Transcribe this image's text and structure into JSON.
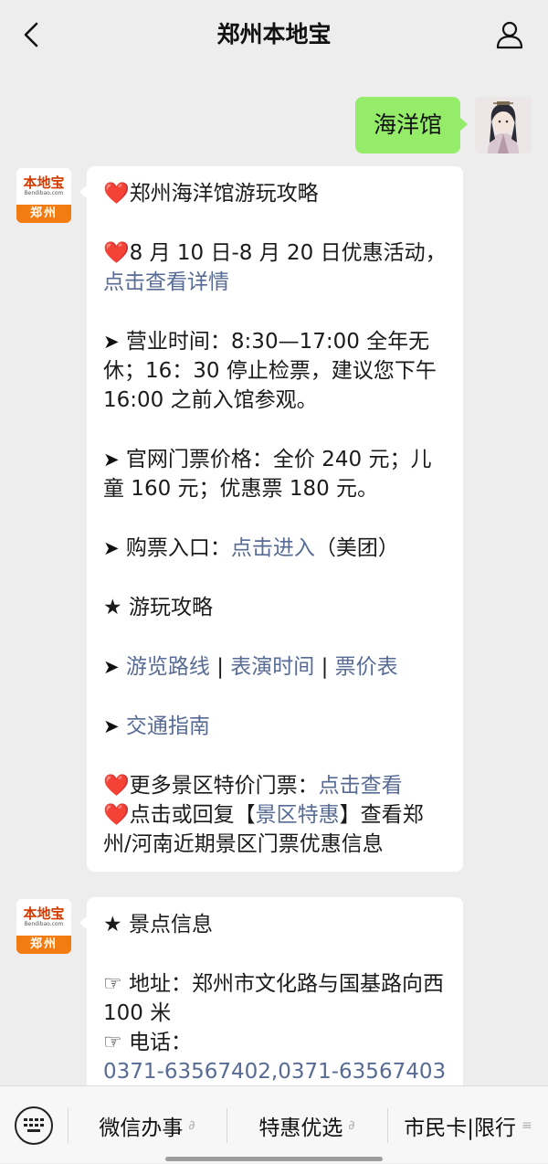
{
  "header": {
    "title": "郑州本地宝"
  },
  "outgoing": {
    "text": "海洋馆"
  },
  "bot": {
    "logo_main": "本地宝",
    "logo_sub": "Bendibao.com",
    "logo_city": "郑州"
  },
  "message1": {
    "title_heart": "❤️",
    "title": "郑州海洋馆游玩攻略",
    "promo_heart": "❤️",
    "promo_text": "8 月 10 日-8 月 20 日优惠活动，",
    "promo_link": "点击查看详情",
    "hours_arrow": "➤",
    "hours_text": "营业时间：8:30—17:00 全年无休；16：30 停止检票，建议您下午 16:00 之前入馆参观。",
    "price_arrow": "➤",
    "price_text": "官网门票价格：全价 240 元；儿童 160 元；优惠票 180 元。",
    "buy_arrow": "➤",
    "buy_label": "购票入口：",
    "buy_link": "点击进入",
    "buy_suffix": "（美团）",
    "guide_star": "★",
    "guide_title": "游玩攻略",
    "links_arrow": "➤",
    "link_route": "游览路线",
    "sep1": " | ",
    "link_show": "表演时间",
    "sep2": " | ",
    "link_price": "票价表",
    "traffic_arrow": "➤",
    "link_traffic": "交通指南",
    "more_heart": "❤️",
    "more_label": "更多景区特价门票：",
    "more_link": "点击查看",
    "reply_heart": "❤️",
    "reply_prefix": "点击或回复【",
    "reply_link": "景区特惠",
    "reply_suffix": "】查看郑州/河南近期景区门票优惠信息"
  },
  "message2": {
    "info_star": "★",
    "info_title": "景点信息",
    "address_icon": "☞",
    "address_text": "地址：郑州市文化路与国基路向西 100 米",
    "phone_icon": "☞",
    "phone_label": "电话：",
    "phone_link": "0371-63567402,0371-63567403"
  },
  "bottom_menu": {
    "item1": "微信办事",
    "item2": "特惠优选",
    "item3": "市民卡|限行",
    "link_mark": "∂",
    "menu_mark": "≡"
  },
  "colors": {
    "outgoing_bubble": "#95ec69",
    "link": "#576b95",
    "heart": "#e0322f",
    "background": "#ededed"
  }
}
